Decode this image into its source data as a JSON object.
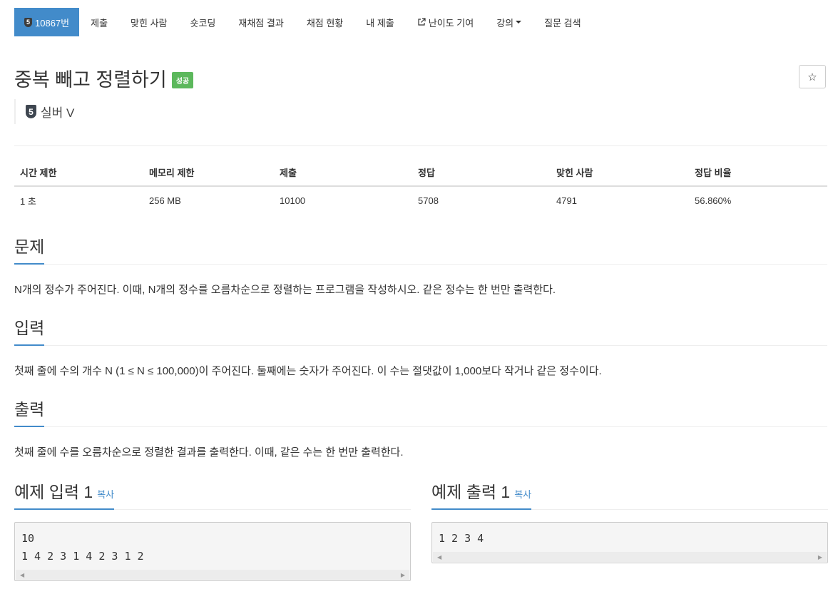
{
  "nav": {
    "problem_number": "10867번",
    "tier_number": "5",
    "items": [
      "제출",
      "맞힌 사람",
      "숏코딩",
      "재채점 결과",
      "채점 현황",
      "내 제출",
      "난이도 기여",
      "강의",
      "질문 검색"
    ]
  },
  "problem": {
    "title": "중복 빼고 정렬하기",
    "result": "성공",
    "tier_number": "5",
    "tier_name": "실버 V",
    "star_glyph": "☆"
  },
  "info": {
    "headers": [
      "시간 제한",
      "메모리 제한",
      "제출",
      "정답",
      "맞힌 사람",
      "정답 비율"
    ],
    "values": [
      "1 초",
      "256 MB",
      "10100",
      "5708",
      "4791",
      "56.860%"
    ]
  },
  "sections": {
    "description_title": "문제",
    "description": "N개의 정수가 주어진다. 이때, N개의 정수를 오름차순으로 정렬하는 프로그램을 작성하시오. 같은 정수는 한 번만 출력한다.",
    "input_title": "입력",
    "input": "첫째 줄에 수의 개수 N (1 ≤ N ≤ 100,000)이 주어진다. 둘째에는 숫자가 주어진다. 이 수는 절댓값이 1,000보다 작거나 같은 정수이다.",
    "output_title": "출력",
    "output": "첫째 줄에 수를 오름차순으로 정렬한 결과를 출력한다. 이때, 같은 수는 한 번만 출력한다."
  },
  "samples": {
    "input_title": "예제 입력 1",
    "output_title": "예제 출력 1",
    "copy_label": "복사",
    "input_text": "10\n1 4 2 3 1 4 2 3 1 2",
    "output_text": "1 2 3 4"
  },
  "colors": {
    "accent": "#428bca",
    "success": "#5cb85c",
    "tier_silver": "#3e4650"
  }
}
